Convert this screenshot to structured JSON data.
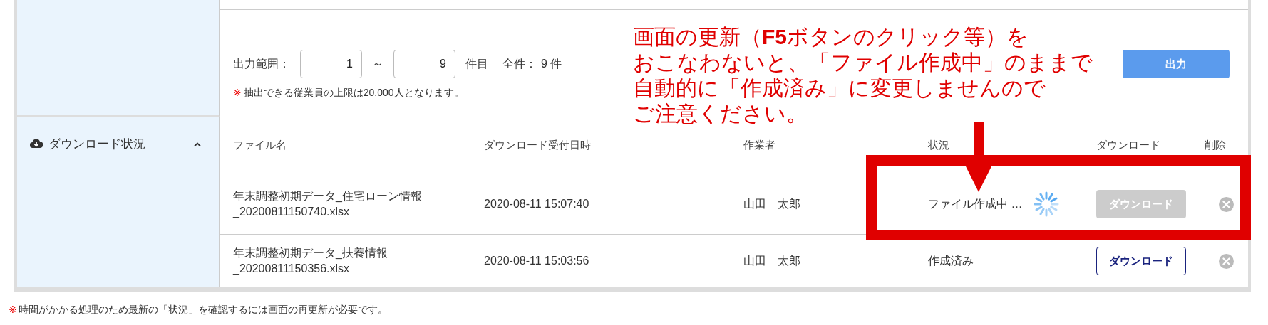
{
  "range": {
    "label": "出力範囲：",
    "from": "1",
    "separator": "～",
    "to": "9",
    "unit": "件目",
    "total_label": "全件：",
    "total": "9 件",
    "note_mark": "※",
    "note": "抽出できる従業員の上限は20,000人となります。",
    "button": "出力"
  },
  "download_section": {
    "title": "ダウンロード状況",
    "expanded": true,
    "columns": [
      "ファイル名",
      "ダウンロード受付日時",
      "作業者",
      "状況",
      "ダウンロード",
      "削除"
    ],
    "rows": [
      {
        "file_name": "年末調整初期データ_住宅ローン情報\n_20200811150740.xlsx",
        "received": "2020-08-11 15:07:40",
        "worker": "山田　太郎",
        "status": "ファイル作成中 …",
        "processing": true,
        "download": "ダウンロード",
        "download_disabled": true
      },
      {
        "file_name": "年末調整初期データ_扶養情報\n_20200811150356.xlsx",
        "received": "2020-08-11 15:03:56",
        "worker": "山田　太郎",
        "status": "作成済み",
        "processing": false,
        "download": "ダウンロード",
        "download_disabled": false
      }
    ]
  },
  "footnote": {
    "mark": "※",
    "text": "時間がかかる処理のため最新の「状況」を確認するには画面の再更新が必要です。"
  },
  "annotation": {
    "lines": [
      "画面の更新（**F5**ボタンのクリック等）を",
      "おこなわないと、「ファイル作成中」のままで",
      "自動的に「作成済み」に変更しませんので",
      "ご注意ください。"
    ]
  }
}
